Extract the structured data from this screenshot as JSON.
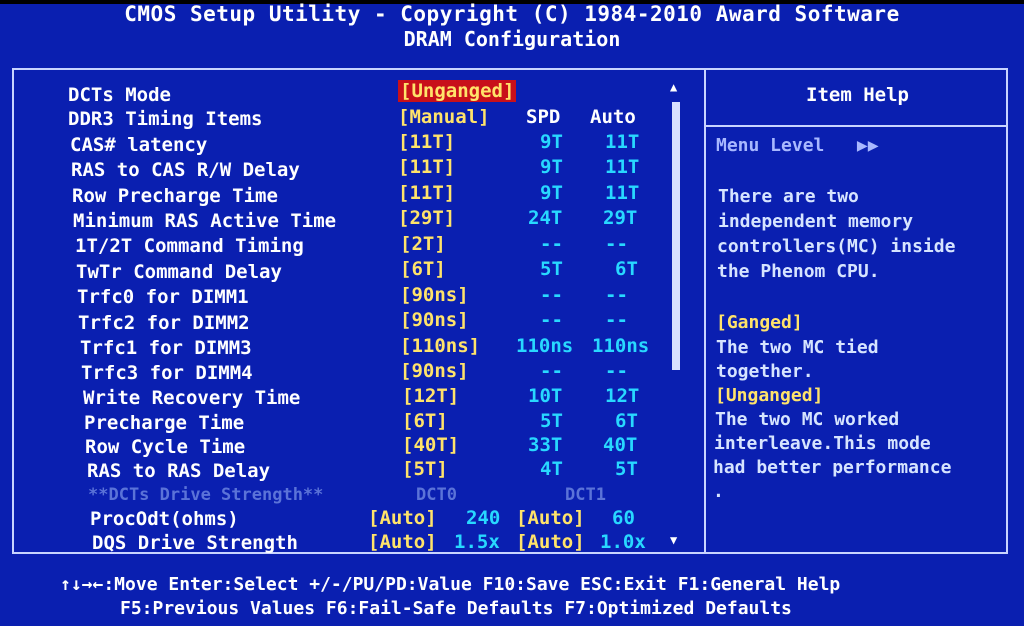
{
  "header": {
    "title": "CMOS Setup Utility - Copyright (C) 1984-2010 Award Software",
    "subtitle": "DRAM Configuration"
  },
  "settings": [
    {
      "label": "DCTs Mode",
      "value": "[Unganged]",
      "spd": "",
      "auto": ""
    },
    {
      "label": "DDR3 Timing Items",
      "value": "[Manual]",
      "spd": "SPD",
      "auto": "Auto"
    },
    {
      "label": "CAS# latency",
      "value": "[11T]",
      "spd": "9T",
      "auto": "11T"
    },
    {
      "label": "RAS to CAS R/W Delay",
      "value": "[11T]",
      "spd": "9T",
      "auto": "11T"
    },
    {
      "label": "Row Precharge Time",
      "value": "[11T]",
      "spd": "9T",
      "auto": "11T"
    },
    {
      "label": "Minimum RAS Active Time",
      "value": "[29T]",
      "spd": "24T",
      "auto": "29T"
    },
    {
      "label": "1T/2T Command Timing",
      "value": "[2T]",
      "spd": "--",
      "auto": "--"
    },
    {
      "label": "TwTr Command Delay",
      "value": "[6T]",
      "spd": "5T",
      "auto": "6T"
    },
    {
      "label": "Trfc0 for DIMM1",
      "value": "[90ns]",
      "spd": "--",
      "auto": "--"
    },
    {
      "label": "Trfc2 for DIMM2",
      "value": "[90ns]",
      "spd": "--",
      "auto": "--"
    },
    {
      "label": "Trfc1 for DIMM3",
      "value": "[110ns]",
      "spd": "110ns",
      "auto": "110ns"
    },
    {
      "label": "Trfc3 for DIMM4",
      "value": "[90ns]",
      "spd": "--",
      "auto": "--"
    },
    {
      "label": "Write Recovery Time",
      "value": "[12T]",
      "spd": "10T",
      "auto": "12T"
    },
    {
      "label": "Precharge Time",
      "value": "[6T]",
      "spd": "5T",
      "auto": "6T"
    },
    {
      "label": "Row Cycle Time",
      "value": "[40T]",
      "spd": "33T",
      "auto": "40T"
    },
    {
      "label": "RAS to RAS Delay",
      "value": "[5T]",
      "spd": "4T",
      "auto": "5T"
    }
  ],
  "drive_strength": {
    "header": "**DCTs Drive Strength**",
    "dct0": "DCT0",
    "dct1": "DCT1",
    "rows": [
      {
        "label": "ProcOdt(ohms)",
        "v0": "[Auto]",
        "d0": "240",
        "v1": "[Auto]",
        "d1": "60"
      },
      {
        "label": "DQS Drive Strength",
        "v0": "[Auto]",
        "d0": "1.5x",
        "v1": "[Auto]",
        "d1": "1.0x"
      }
    ]
  },
  "scroll": {
    "up": "▲",
    "down": "▼"
  },
  "help": {
    "title": "Item Help",
    "menu_level": "Menu Level",
    "menu_level_marker": "▶▶",
    "lines": [
      "There are two",
      "independent memory",
      "controllers(MC) inside",
      "the Phenom CPU.",
      "",
      "[Ganged]",
      "The two MC tied",
      "together.",
      "[Unganged]",
      "The two MC worked",
      "interleave.This mode",
      "had better performance",
      "."
    ]
  },
  "footer": {
    "line1": "↑↓→←:Move  Enter:Select  +/-/PU/PD:Value  F10:Save  ESC:Exit  F1:General Help",
    "line2": "F5:Previous Values  F6:Fail-Safe Defaults  F7:Optimized Defaults"
  },
  "colors": {
    "background": "#0a1fb0",
    "label": "#ffffff",
    "value": "#ffe36a",
    "reference": "#28d8ff",
    "selection": "#c8101a",
    "disabled": "#5b73d8"
  }
}
